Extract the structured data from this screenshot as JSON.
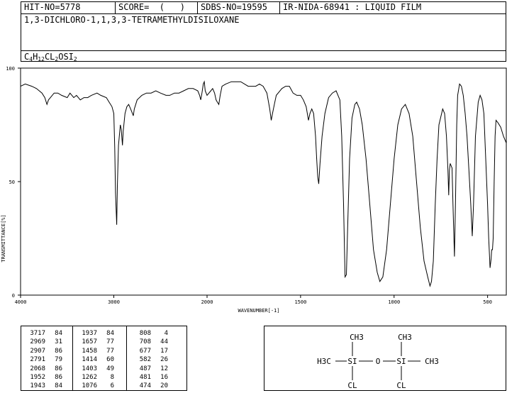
{
  "header": {
    "hit_no": "HIT-NO=5778",
    "score": "SCORE=  (   )",
    "sdbs_no": "SDBS-NO=19595",
    "ir_info": "IR-NIDA-68941 : LIQUID FILM",
    "compound_name": "1,3-DICHLORO-1,1,3,3-TETRAMETHYLDISILOXANE",
    "formula": {
      "parts": [
        "C",
        "4",
        "H",
        "12",
        "CL",
        "2",
        "OSI",
        "2"
      ]
    }
  },
  "chart_data": {
    "type": "line",
    "title": "",
    "xlabel": "WAVENUMBER[-1]",
    "ylabel": "TRANSMITTANCE[%]",
    "xlim": [
      4000,
      400
    ],
    "ylim": [
      0,
      100
    ],
    "x_ticks": [
      4000,
      3000,
      2000,
      1500,
      1000,
      500
    ],
    "y_ticks": [
      0,
      50,
      100
    ],
    "x_tick_labels": [
      "4000",
      "3000",
      "2000",
      "1500",
      "1000",
      "500"
    ],
    "y_tick_labels": [
      "0",
      "50",
      "100"
    ],
    "grid": false,
    "series": [
      {
        "values": [
          [
            4000,
            92
          ],
          [
            3950,
            93
          ],
          [
            3880,
            92
          ],
          [
            3830,
            91
          ],
          [
            3800,
            90
          ],
          [
            3770,
            89
          ],
          [
            3740,
            87
          ],
          [
            3717,
            84
          ],
          [
            3700,
            86
          ],
          [
            3680,
            87
          ],
          [
            3640,
            89
          ],
          [
            3600,
            89
          ],
          [
            3560,
            88
          ],
          [
            3500,
            87
          ],
          [
            3470,
            89
          ],
          [
            3430,
            87
          ],
          [
            3400,
            88
          ],
          [
            3360,
            86
          ],
          [
            3320,
            87
          ],
          [
            3280,
            87
          ],
          [
            3240,
            88
          ],
          [
            3180,
            89
          ],
          [
            3140,
            88
          ],
          [
            3080,
            87
          ],
          [
            3050,
            85
          ],
          [
            3020,
            83
          ],
          [
            3000,
            80
          ],
          [
            2990,
            65
          ],
          [
            2982,
            45
          ],
          [
            2969,
            31
          ],
          [
            2962,
            48
          ],
          [
            2950,
            66
          ],
          [
            2930,
            75
          ],
          [
            2920,
            73
          ],
          [
            2907,
            66
          ],
          [
            2900,
            72
          ],
          [
            2880,
            80
          ],
          [
            2860,
            83
          ],
          [
            2840,
            84
          ],
          [
            2820,
            82
          ],
          [
            2800,
            80
          ],
          [
            2791,
            79
          ],
          [
            2780,
            82
          ],
          [
            2750,
            86
          ],
          [
            2700,
            88
          ],
          [
            2650,
            89
          ],
          [
            2600,
            89
          ],
          [
            2550,
            90
          ],
          [
            2500,
            89
          ],
          [
            2440,
            88
          ],
          [
            2400,
            88
          ],
          [
            2350,
            89
          ],
          [
            2300,
            89
          ],
          [
            2250,
            90
          ],
          [
            2200,
            91
          ],
          [
            2150,
            91
          ],
          [
            2100,
            90
          ],
          [
            2080,
            88
          ],
          [
            2068,
            86
          ],
          [
            2055,
            89
          ],
          [
            2040,
            93
          ],
          [
            2030,
            94
          ],
          [
            2020,
            90
          ],
          [
            2000,
            88
          ],
          [
            1980,
            90
          ],
          [
            1970,
            91
          ],
          [
            1960,
            89
          ],
          [
            1952,
            86
          ],
          [
            1945,
            85
          ],
          [
            1937,
            84
          ],
          [
            1930,
            88
          ],
          [
            1920,
            92
          ],
          [
            1900,
            93
          ],
          [
            1870,
            94
          ],
          [
            1850,
            94
          ],
          [
            1820,
            94
          ],
          [
            1800,
            93
          ],
          [
            1780,
            92
          ],
          [
            1760,
            92
          ],
          [
            1740,
            92
          ],
          [
            1720,
            93
          ],
          [
            1700,
            92
          ],
          [
            1680,
            89
          ],
          [
            1665,
            82
          ],
          [
            1657,
            77
          ],
          [
            1650,
            80
          ],
          [
            1640,
            84
          ],
          [
            1630,
            88
          ],
          [
            1600,
            91
          ],
          [
            1580,
            92
          ],
          [
            1560,
            92
          ],
          [
            1540,
            89
          ],
          [
            1520,
            88
          ],
          [
            1500,
            88
          ],
          [
            1485,
            86
          ],
          [
            1470,
            83
          ],
          [
            1458,
            77
          ],
          [
            1450,
            80
          ],
          [
            1440,
            82
          ],
          [
            1430,
            80
          ],
          [
            1420,
            70
          ],
          [
            1414,
            60
          ],
          [
            1408,
            52
          ],
          [
            1403,
            49
          ],
          [
            1396,
            58
          ],
          [
            1385,
            70
          ],
          [
            1370,
            80
          ],
          [
            1350,
            87
          ],
          [
            1330,
            89
          ],
          [
            1310,
            90
          ],
          [
            1290,
            86
          ],
          [
            1280,
            70
          ],
          [
            1270,
            40
          ],
          [
            1262,
            8
          ],
          [
            1255,
            9
          ],
          [
            1248,
            30
          ],
          [
            1238,
            60
          ],
          [
            1225,
            78
          ],
          [
            1210,
            84
          ],
          [
            1200,
            85
          ],
          [
            1185,
            82
          ],
          [
            1170,
            75
          ],
          [
            1150,
            60
          ],
          [
            1130,
            40
          ],
          [
            1110,
            20
          ],
          [
            1090,
            10
          ],
          [
            1076,
            6
          ],
          [
            1060,
            8
          ],
          [
            1040,
            20
          ],
          [
            1020,
            40
          ],
          [
            1000,
            60
          ],
          [
            980,
            75
          ],
          [
            960,
            82
          ],
          [
            940,
            84
          ],
          [
            920,
            80
          ],
          [
            900,
            70
          ],
          [
            880,
            50
          ],
          [
            860,
            30
          ],
          [
            840,
            15
          ],
          [
            820,
            8
          ],
          [
            808,
            4
          ],
          [
            800,
            6
          ],
          [
            790,
            15
          ],
          [
            780,
            40
          ],
          [
            770,
            60
          ],
          [
            760,
            75
          ],
          [
            740,
            82
          ],
          [
            730,
            80
          ],
          [
            720,
            70
          ],
          [
            712,
            55
          ],
          [
            708,
            44
          ],
          [
            704,
            55
          ],
          [
            700,
            58
          ],
          [
            690,
            56
          ],
          [
            685,
            40
          ],
          [
            677,
            17
          ],
          [
            672,
            40
          ],
          [
            665,
            75
          ],
          [
            660,
            88
          ],
          [
            650,
            93
          ],
          [
            640,
            92
          ],
          [
            630,
            88
          ],
          [
            620,
            80
          ],
          [
            610,
            70
          ],
          [
            600,
            55
          ],
          [
            590,
            40
          ],
          [
            582,
            26
          ],
          [
            575,
            40
          ],
          [
            565,
            70
          ],
          [
            550,
            85
          ],
          [
            540,
            88
          ],
          [
            530,
            86
          ],
          [
            520,
            80
          ],
          [
            510,
            60
          ],
          [
            500,
            40
          ],
          [
            494,
            25
          ],
          [
            487,
            12
          ],
          [
            481,
            16
          ],
          [
            478,
            20
          ],
          [
            474,
            20
          ],
          [
            470,
            25
          ],
          [
            465,
            50
          ],
          [
            460,
            70
          ],
          [
            455,
            77
          ],
          [
            445,
            76
          ],
          [
            430,
            74
          ],
          [
            415,
            70
          ],
          [
            400,
            67
          ]
        ]
      }
    ]
  },
  "peak_table": {
    "columns": [
      [
        [
          "3717",
          "84"
        ],
        [
          "2969",
          "31"
        ],
        [
          "2907",
          "86"
        ],
        [
          "2791",
          "79"
        ],
        [
          "2068",
          "86"
        ],
        [
          "1952",
          "86"
        ],
        [
          "1943",
          "84"
        ]
      ],
      [
        [
          "1937",
          "84"
        ],
        [
          "1657",
          "77"
        ],
        [
          "1458",
          "77"
        ],
        [
          "1414",
          "60"
        ],
        [
          "1403",
          "49"
        ],
        [
          "1262",
          "8"
        ],
        [
          "1076",
          "6"
        ]
      ],
      [
        [
          "808",
          "4"
        ],
        [
          "708",
          "44"
        ],
        [
          "677",
          "17"
        ],
        [
          "582",
          "26"
        ],
        [
          "487",
          "12"
        ],
        [
          "481",
          "16"
        ],
        [
          "474",
          "20"
        ]
      ]
    ]
  },
  "structure": {
    "top_left": "CH3",
    "top_right": "CH3",
    "left_group": "H3C",
    "si_left": "SI",
    "oxygen": "O",
    "si_right": "SI",
    "right_group": "CH3",
    "bottom_left": "CL",
    "bottom_right": "CL"
  }
}
